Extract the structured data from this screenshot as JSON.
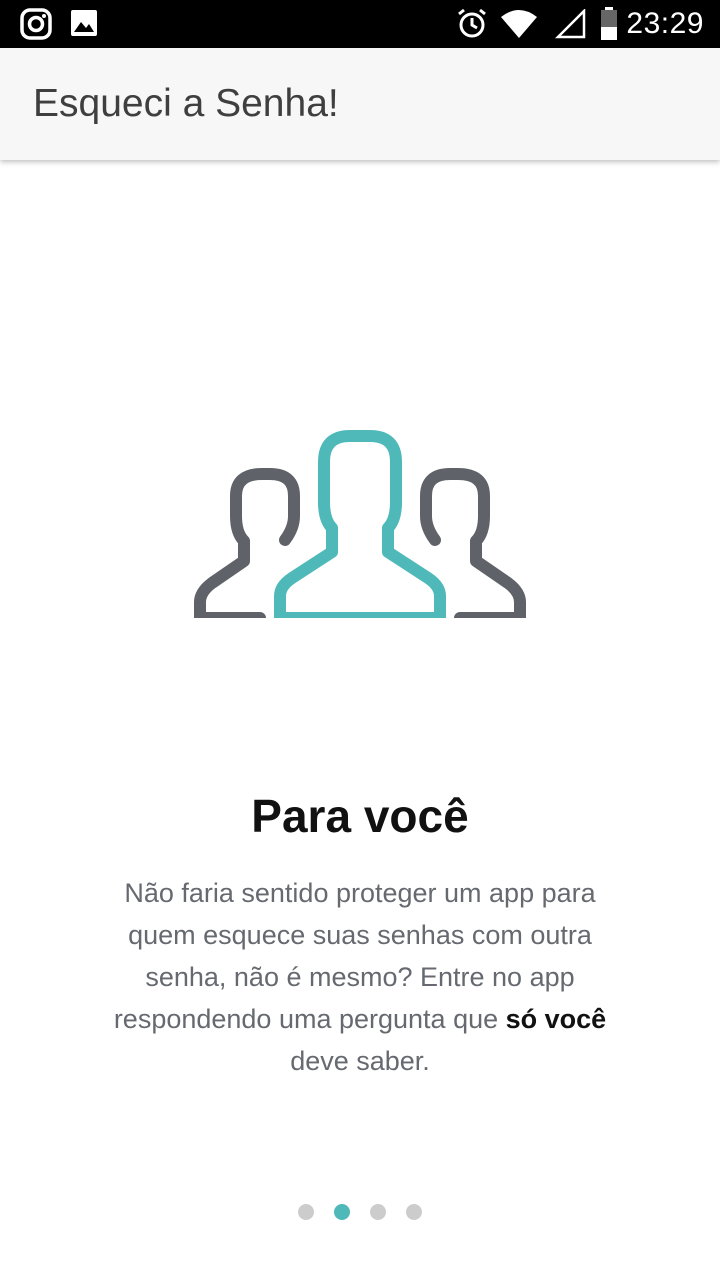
{
  "status_bar": {
    "time": "23:29",
    "icons": [
      "instagram-icon",
      "image-icon",
      "alarm-icon",
      "wifi-icon",
      "signal-icon",
      "battery-icon"
    ]
  },
  "app_bar": {
    "title": "Esqueci a Senha!"
  },
  "slide": {
    "illustration": "people-group-icon",
    "title": "Para você",
    "description_before": "Não faria sentido proteger um app para quem esquece suas senhas com outra senha, não é mesmo? Entre no app respondendo uma pergunta que ",
    "description_emphasis": "só você",
    "description_after": " deve saber."
  },
  "pager": {
    "total": 4,
    "active_index": 1
  },
  "colors": {
    "accent": "#4fb9b9",
    "icon_gray": "#5f6268",
    "dot_inactive": "#cccccc",
    "app_bar_bg": "#f7f7f7",
    "status_bar_bg": "#000000"
  }
}
